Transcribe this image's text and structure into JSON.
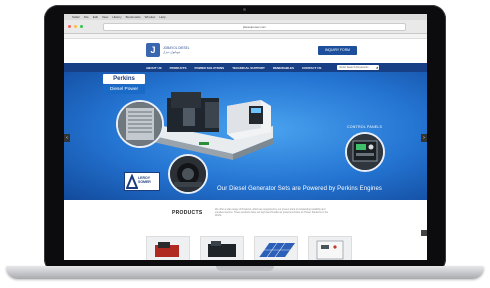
{
  "browser": {
    "menubar_items": [
      "Safari",
      "File",
      "Edit",
      "View",
      "History",
      "Bookmarks",
      "Window",
      "Help"
    ],
    "address": "jdieselpower.com"
  },
  "site": {
    "logo_name": "JOBAYOL DIESEL",
    "logo_sub": "جوبايول ديزل",
    "inquiry_button": "INQUIRY FORM",
    "nav_items": [
      "ABOUT US",
      "PRODUCTS",
      "POWER SOLUTIONS",
      "TECHNICAL SUPPORT",
      "RENEWABLES",
      "CONTACT US"
    ],
    "search_placeholder": "Enter Search Keywords"
  },
  "hero": {
    "perkins_brand": "Perkins",
    "perkins_sub": "Diesel Power",
    "control_panels_label": "CONTROL PANELS",
    "leroy_label": "LEROY SOMER",
    "tagline": "Our Diesel Generator Sets are Powered by Perkins Engines",
    "prev_arrow": "‹",
    "next_arrow": "›"
  },
  "products": {
    "title": "PRODUCTS",
    "description": "We offer a wide range of Products, which are supported by our proven track of outstanding reliability and excellent service. These products have set high benchmarks as preferred choice for Power Solutions in the World."
  },
  "colors": {
    "nav": "#173f86",
    "hero": "#2474d2",
    "button": "#1d4f9c"
  }
}
